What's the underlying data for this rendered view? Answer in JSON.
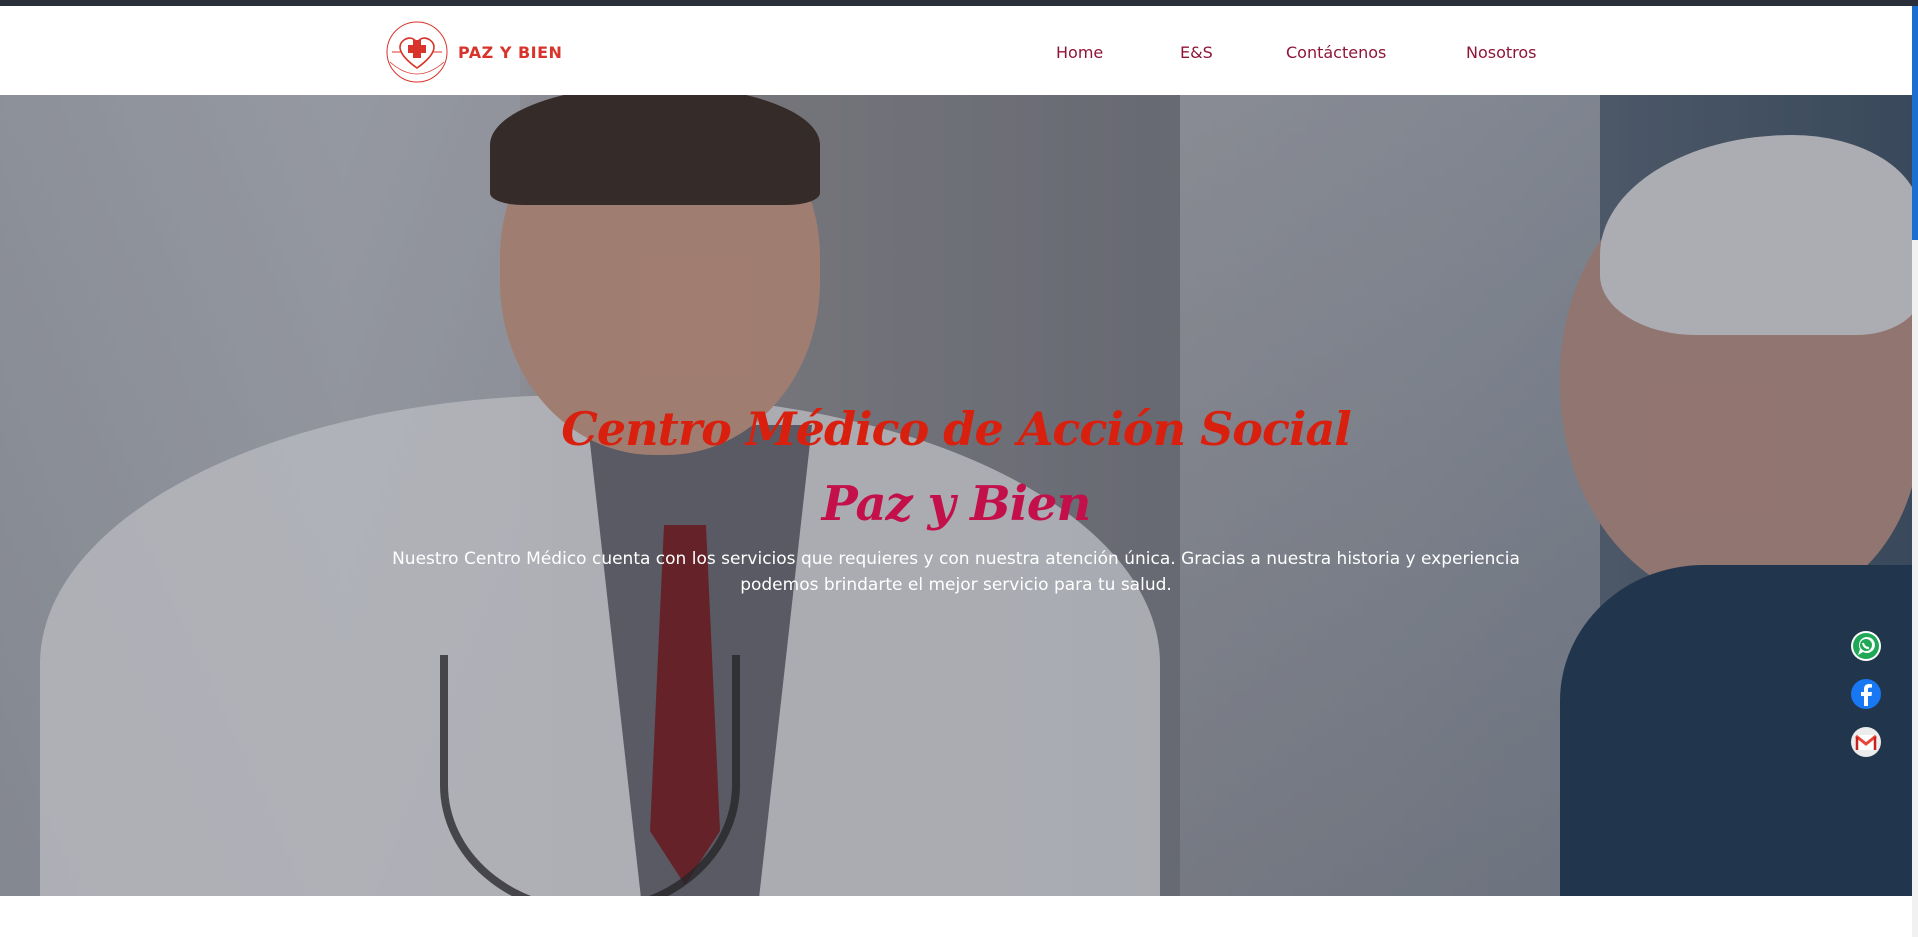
{
  "brand": {
    "name": "PAZ Y BIEN",
    "logo_icon": "heart-cross-seal-icon",
    "logo_arc_text": "CENTRO MÉDICO DE ACCIÓN SOCIAL",
    "color": "#d9342b"
  },
  "nav": {
    "items": [
      {
        "label": "Home"
      },
      {
        "label": "E&S"
      },
      {
        "label": "Contáctenos"
      },
      {
        "label": "Nosotros"
      }
    ],
    "color": "#8e1537"
  },
  "hero": {
    "title": "Centro Médico de Acción Social",
    "subtitle": "Paz y Bien",
    "description": "Nuestro Centro Médico cuenta con los servicios que requieres y con nuestra atención única. Gracias a nuestra historia y experiencia podemos brindarte el mejor servicio para tu salud.",
    "title_color": "#d9200f",
    "subtitle_color": "#c4104a",
    "image": "doctor-consulting-elderly-patient-photo"
  },
  "social": [
    {
      "icon": "whatsapp-icon",
      "color": "#25d366"
    },
    {
      "icon": "facebook-icon",
      "color": "#1877f2"
    },
    {
      "icon": "gmail-icon",
      "color": "#ea4335"
    }
  ]
}
